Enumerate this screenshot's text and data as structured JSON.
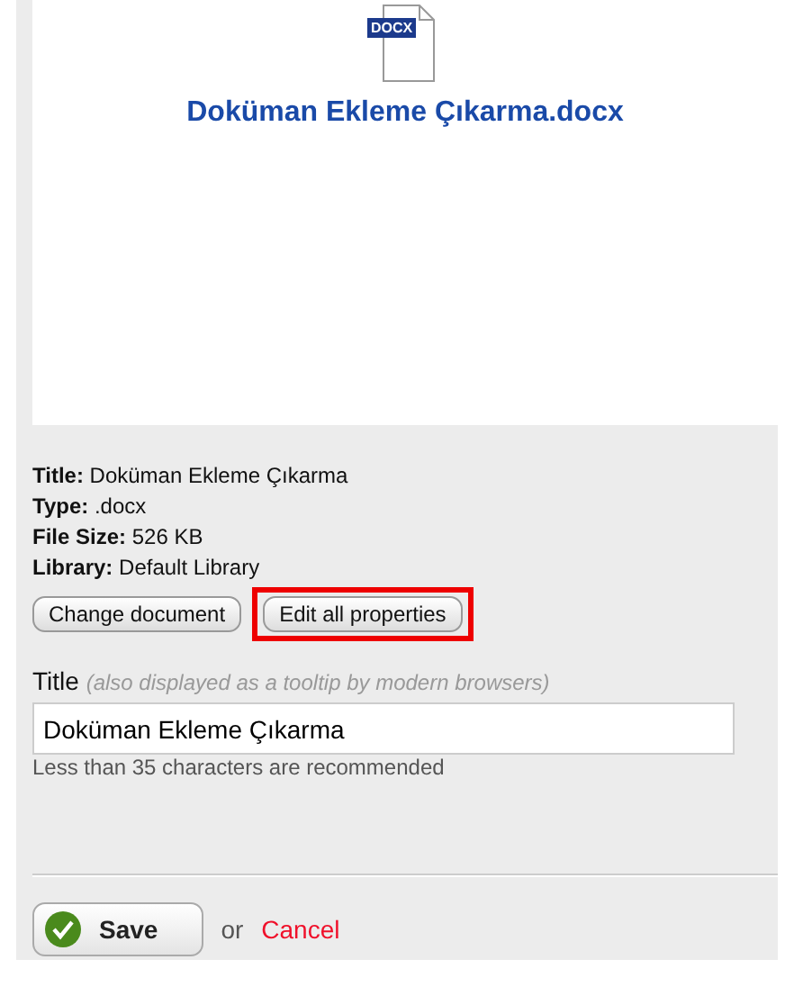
{
  "preview": {
    "file_badge": "DOCX",
    "file_name": "Doküman Ekleme Çıkarma.docx"
  },
  "info": [
    {
      "label": "Title:",
      "value": "Doküman Ekleme Çıkarma"
    },
    {
      "label": "Type:",
      "value": ".docx"
    },
    {
      "label": "File Size:",
      "value": "526 KB"
    },
    {
      "label": "Library:",
      "value": "Default Library"
    }
  ],
  "buttons": [
    {
      "label": "Change document",
      "highlighted": false
    },
    {
      "label": "Edit all properties",
      "highlighted": true
    }
  ],
  "title_field": {
    "label": "Title",
    "hint": "(also displayed as a tooltip by modern browsers)",
    "value": "Doküman Ekleme Çıkarma",
    "help": "Less than 35 characters are recommended"
  },
  "actions": {
    "save": "Save",
    "separator": "or",
    "cancel": "Cancel"
  }
}
